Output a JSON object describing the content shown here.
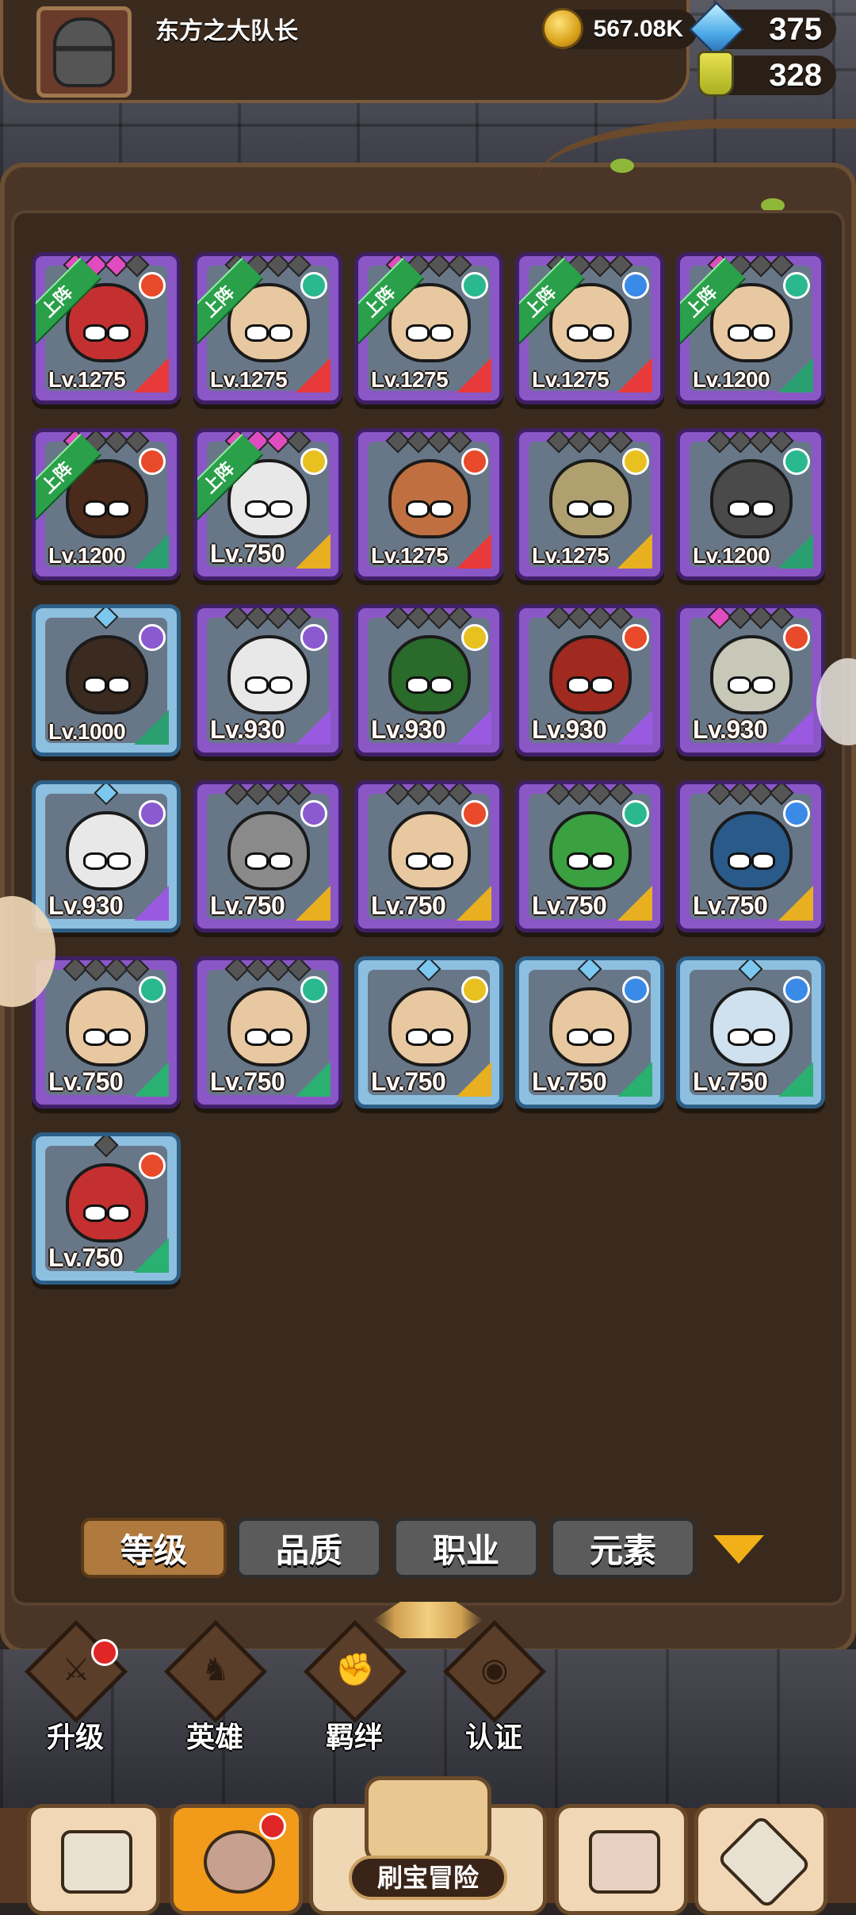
{
  "header": {
    "player_name": "东方之大队长",
    "gold": "567.08K",
    "gems": "375",
    "potions": "328"
  },
  "heroes": [
    {
      "level": "Lv.1275",
      "deployed": true,
      "element": "fire",
      "class": "warrior",
      "rarity": "purple",
      "stars": [
        "pink",
        "pink",
        "pink",
        "gray"
      ],
      "face": "#c43030"
    },
    {
      "level": "Lv.1275",
      "deployed": true,
      "element": "wind",
      "class": "warrior",
      "rarity": "purple",
      "stars": [
        "gray",
        "gray",
        "gray",
        "gray"
      ],
      "face": "#e8c8a0"
    },
    {
      "level": "Lv.1275",
      "deployed": true,
      "element": "wind",
      "class": "warrior",
      "rarity": "purple",
      "stars": [
        "pink",
        "gray",
        "gray",
        "gray"
      ],
      "face": "#e8c8a0"
    },
    {
      "level": "Lv.1275",
      "deployed": true,
      "element": "water",
      "class": "warrior",
      "rarity": "purple",
      "stars": [
        "gray",
        "gray",
        "gray",
        "gray"
      ],
      "face": "#e8c8a0"
    },
    {
      "level": "Lv.1200",
      "deployed": true,
      "element": "wind",
      "class": "tank",
      "rarity": "purple",
      "stars": [
        "pink",
        "gray",
        "gray",
        "gray"
      ],
      "face": "#e8c8a0"
    },
    {
      "level": "Lv.1200",
      "deployed": true,
      "element": "fire",
      "class": "tank",
      "rarity": "purple",
      "stars": [
        "pink",
        "gray",
        "gray",
        "gray"
      ],
      "face": "#4a2a1a"
    },
    {
      "level": "Lv.750",
      "deployed": true,
      "element": "light",
      "class": "holy",
      "rarity": "purple",
      "stars": [
        "pink",
        "pink",
        "pink",
        "gray"
      ],
      "face": "#e8e8e8"
    },
    {
      "level": "Lv.1275",
      "deployed": false,
      "element": "fire",
      "class": "warrior",
      "rarity": "purple",
      "stars": [
        "gray",
        "gray",
        "gray",
        "gray"
      ],
      "face": "#c07040"
    },
    {
      "level": "Lv.1275",
      "deployed": false,
      "element": "light",
      "class": "holy",
      "rarity": "purple",
      "stars": [
        "gray",
        "gray",
        "gray",
        "gray"
      ],
      "face": "#b0a070"
    },
    {
      "level": "Lv.1200",
      "deployed": false,
      "element": "wind",
      "class": "tank",
      "rarity": "purple",
      "stars": [
        "gray",
        "gray",
        "gray",
        "gray"
      ],
      "face": "#4a4a4a"
    },
    {
      "level": "Lv.1000",
      "deployed": false,
      "element": "dark",
      "class": "tank",
      "rarity": "blue",
      "stars": [
        "blue"
      ],
      "face": "#3a2a20"
    },
    {
      "level": "Lv.930",
      "deployed": false,
      "element": "dark",
      "class": "mage",
      "rarity": "purple",
      "stars": [
        "gray",
        "gray",
        "gray",
        "gray"
      ],
      "face": "#e8e8e8"
    },
    {
      "level": "Lv.930",
      "deployed": false,
      "element": "light",
      "class": "mage",
      "rarity": "purple",
      "stars": [
        "gray",
        "gray",
        "gray",
        "gray"
      ],
      "face": "#2a6a2a"
    },
    {
      "level": "Lv.930",
      "deployed": false,
      "element": "fire",
      "class": "mage",
      "rarity": "purple",
      "stars": [
        "gray",
        "gray",
        "gray",
        "gray"
      ],
      "face": "#a02a20"
    },
    {
      "level": "Lv.930",
      "deployed": false,
      "element": "fire",
      "class": "mage",
      "rarity": "purple",
      "stars": [
        "pink",
        "gray",
        "gray",
        "gray"
      ],
      "face": "#c8c8b8"
    },
    {
      "level": "Lv.930",
      "deployed": false,
      "element": "dark",
      "class": "mage",
      "rarity": "blue",
      "stars": [
        "blue"
      ],
      "face": "#e8e8e8"
    },
    {
      "level": "Lv.750",
      "deployed": false,
      "element": "dark",
      "class": "holy",
      "rarity": "purple",
      "stars": [
        "gray",
        "gray",
        "gray",
        "gray"
      ],
      "face": "#8a8a8a"
    },
    {
      "level": "Lv.750",
      "deployed": false,
      "element": "fire",
      "class": "holy",
      "rarity": "purple",
      "stars": [
        "gray",
        "gray",
        "gray",
        "gray"
      ],
      "face": "#e8c8a0"
    },
    {
      "level": "Lv.750",
      "deployed": false,
      "element": "wind",
      "class": "holy",
      "rarity": "purple",
      "stars": [
        "gray",
        "gray",
        "gray",
        "gray"
      ],
      "face": "#3aa040"
    },
    {
      "level": "Lv.750",
      "deployed": false,
      "element": "water",
      "class": "holy",
      "rarity": "purple",
      "stars": [
        "gray",
        "gray",
        "gray",
        "gray"
      ],
      "face": "#2a5a8a"
    },
    {
      "level": "Lv.750",
      "deployed": false,
      "element": "wind",
      "class": "archer",
      "rarity": "purple",
      "stars": [
        "gray",
        "gray",
        "gray",
        "gray"
      ],
      "face": "#e8c8a0"
    },
    {
      "level": "Lv.750",
      "deployed": false,
      "element": "wind",
      "class": "archer",
      "rarity": "purple",
      "stars": [
        "gray",
        "gray",
        "gray",
        "gray"
      ],
      "face": "#e8c8a0"
    },
    {
      "level": "Lv.750",
      "deployed": false,
      "element": "light",
      "class": "holy",
      "rarity": "blue",
      "stars": [
        "blue"
      ],
      "face": "#e8c8a0"
    },
    {
      "level": "Lv.750",
      "deployed": false,
      "element": "water",
      "class": "archer",
      "rarity": "blue",
      "stars": [
        "blue"
      ],
      "face": "#e8c8a0"
    },
    {
      "level": "Lv.750",
      "deployed": false,
      "element": "water",
      "class": "archer",
      "rarity": "blue",
      "stars": [
        "blue"
      ],
      "face": "#cfe0ee"
    },
    {
      "level": "Lv.750",
      "deployed": false,
      "element": "fire",
      "class": "archer",
      "rarity": "blue",
      "stars": [
        "gray"
      ],
      "face": "#c43030"
    }
  ],
  "deployed_label": "上阵",
  "sort_tabs": [
    {
      "label": "等级",
      "active": true
    },
    {
      "label": "品质",
      "active": false
    },
    {
      "label": "职业",
      "active": false
    },
    {
      "label": "元素",
      "active": false
    }
  ],
  "sub_nav": [
    {
      "label": "升级",
      "icon": "sword-icon",
      "badge": true,
      "active": false
    },
    {
      "label": "英雄",
      "icon": "hero-icon",
      "badge": false,
      "active": true
    },
    {
      "label": "羁绊",
      "icon": "fist-icon",
      "badge": false,
      "active": false
    },
    {
      "label": "认证",
      "icon": "eye-icon",
      "badge": false,
      "active": false
    }
  ],
  "bottom_nav": {
    "adventure_label": "刷宝冒险"
  },
  "colors": {
    "fire": "#e84a2a",
    "wind": "#2ab890",
    "water": "#3a8ae8",
    "light": "#e8c020",
    "dark": "#8a5ad0",
    "warrior": "#e83a3a",
    "tank": "#2aa070",
    "holy": "#e8b020",
    "mage": "#9a5ae0",
    "archer": "#2ab070"
  }
}
